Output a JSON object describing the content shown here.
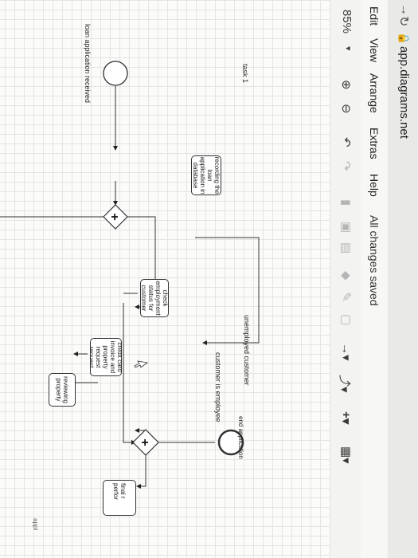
{
  "browser": {
    "url": "app.diagrams.net"
  },
  "menu": {
    "items": [
      "Edit",
      "View",
      "Arrange",
      "Extras",
      "Help"
    ],
    "status": "All changes saved"
  },
  "toolbar": {
    "zoom": "85%"
  },
  "diagram": {
    "pool_label": "task 1",
    "start_event_label": "loan application received",
    "end_event_label": "end application",
    "tasks": {
      "recording": "recording the loan application in database",
      "check_employment": "check employment status for customer",
      "credit_card": "credit card invoice and property request request",
      "reviewing": "reviewing property",
      "final": "final r perfor"
    },
    "flows": {
      "unemployed": "unemployed customer",
      "employee": "customer is employee"
    },
    "edge_text": "appl"
  }
}
